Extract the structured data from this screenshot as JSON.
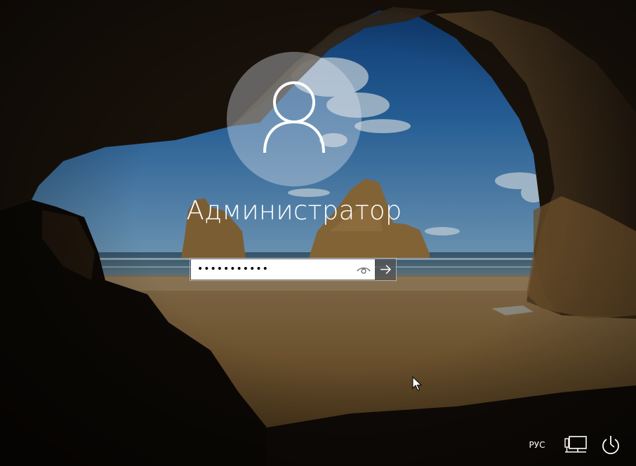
{
  "screen": {
    "type": "windows-lock-screen"
  },
  "user": {
    "name": "Администратор",
    "avatar_icon": "user-silhouette-icon"
  },
  "password": {
    "masked_value": "•••••••••••",
    "reveal_icon": "eye-icon",
    "submit_icon": "arrow-right-icon"
  },
  "tray": {
    "language": "РУС",
    "network_icon": "network-monitor-icon",
    "power_icon": "power-accessibility-icon"
  },
  "colors": {
    "text": "#ffffff",
    "field_background": "#ffffff",
    "sky": "#1f5a9c",
    "sand": "#8a6a3c",
    "rock": "#3a2a1a"
  }
}
